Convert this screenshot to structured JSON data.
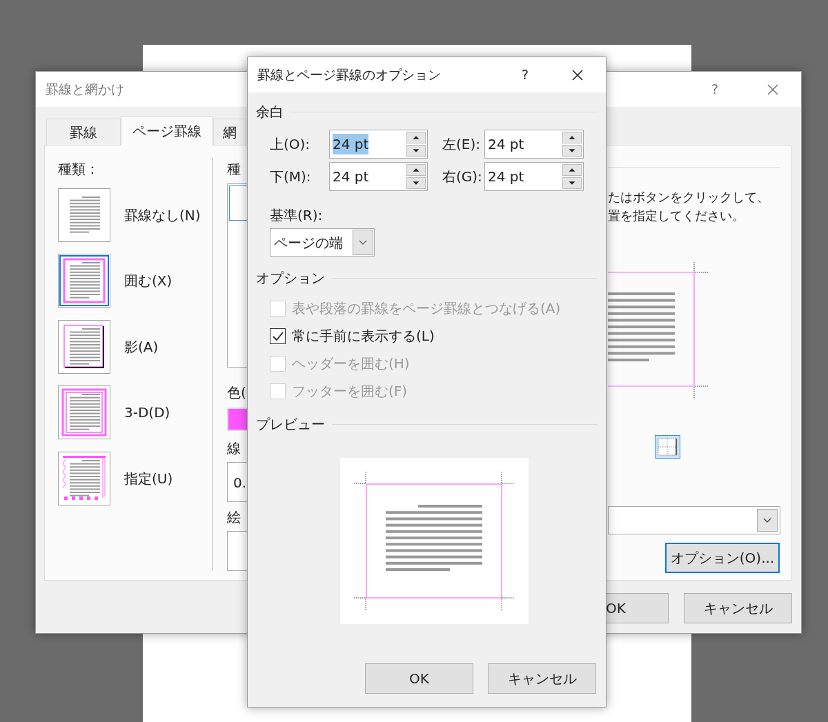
{
  "back_dialog": {
    "title": "罫線と網かけ",
    "help": "?",
    "tabs": [
      {
        "label": "罫線",
        "selected": false
      },
      {
        "label": "ページ罫線",
        "selected": true
      },
      {
        "label": "網",
        "selected": false
      }
    ],
    "setting_label": "種類：",
    "settings": [
      {
        "kind": "none",
        "label": "罫線なし(N)",
        "selected": false
      },
      {
        "kind": "box",
        "label": "囲む(X)",
        "selected": true
      },
      {
        "kind": "shadow",
        "label": "影(A)",
        "selected": false
      },
      {
        "kind": "double",
        "label": "3-D(D)",
        "selected": false
      },
      {
        "kind": "custom",
        "label": "指定(U)",
        "selected": false
      }
    ],
    "style_label": "種",
    "color_label": "色(",
    "width_label": "線",
    "width_value": "0.",
    "art_label": "絵",
    "instructions": [
      "たはボタンをクリックして、",
      "置を指定してください。"
    ],
    "options_button": "オプション(O)...",
    "buttons": [
      "OK",
      "キャンセル"
    ]
  },
  "options_dialog": {
    "title": "罫線とページ罫線のオプション",
    "help": "?",
    "margin_section": "余白",
    "margins": [
      {
        "label": "上(O):",
        "value": "24 pt",
        "text_selected": true
      },
      {
        "label": "左(E):",
        "value": "24 pt",
        "text_selected": false
      },
      {
        "label": "下(M):",
        "value": "24 pt",
        "text_selected": false
      },
      {
        "label": "右(G):",
        "value": "24 pt",
        "text_selected": false
      }
    ],
    "measure_from": {
      "label": "基準(R):",
      "value": "ページの端"
    },
    "options_section": "オプション",
    "options": [
      {
        "label": "表や段落の罫線をページ罫線とつなげる(A)",
        "checked": false,
        "disabled": true
      },
      {
        "label": "常に手前に表示する(L)",
        "checked": true,
        "disabled": false
      },
      {
        "label": "ヘッダーを囲む(H)",
        "checked": false,
        "disabled": true
      },
      {
        "label": "フッターを囲む(F)",
        "checked": false,
        "disabled": true
      }
    ],
    "preview_section": "プレビュー",
    "buttons": [
      "OK",
      "キャンセル"
    ]
  }
}
